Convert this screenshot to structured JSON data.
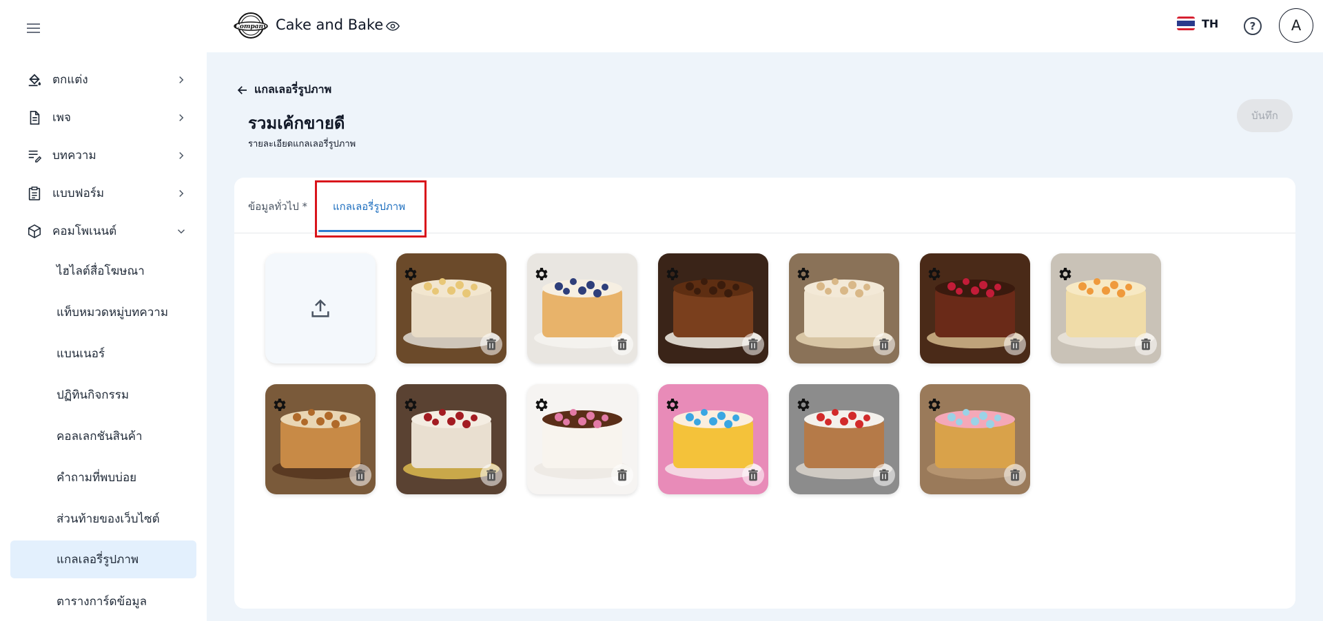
{
  "header": {
    "logo_text": "Company",
    "app_title": "Cake and Bake",
    "language": "TH",
    "avatar_initial": "A"
  },
  "sidebar": {
    "items": [
      {
        "label": "ตกแต่ง",
        "icon": "paint-bucket-icon"
      },
      {
        "label": "เพจ",
        "icon": "document-icon"
      },
      {
        "label": "บทความ",
        "icon": "article-edit-icon"
      },
      {
        "label": "แบบฟอร์ม",
        "icon": "clipboard-form-icon"
      },
      {
        "label": "คอมโพเนนต์",
        "icon": "cube-icon"
      }
    ],
    "subitems": [
      {
        "label": "ไฮไลต์สื่อโฆษณา"
      },
      {
        "label": "แท็บหมวดหมู่บทความ"
      },
      {
        "label": "แบนเนอร์"
      },
      {
        "label": "ปฏิทินกิจกรรม"
      },
      {
        "label": "คอลเลกชันสินค้า"
      },
      {
        "label": "คำถามที่พบบ่อย"
      },
      {
        "label": "ส่วนท้ายของเว็บไซต์"
      },
      {
        "label": "แกลเลอรี่รูปภาพ",
        "active": true
      },
      {
        "label": "ตารางการ์ดข้อมูล"
      }
    ]
  },
  "page": {
    "back_label": "แกลเลอรี่รูปภาพ",
    "title": "รวมเค้กขายดี",
    "subtitle": "รายละเอียดแกลเลอรี่รูปภาพ",
    "save_label": "บันทึก"
  },
  "tabs": [
    {
      "label": "ข้อมูลทั่วไป *",
      "active": false
    },
    {
      "label": "แกลเลอรี่รูปภาพ",
      "active": true
    }
  ],
  "gallery": {
    "upload_icon": "upload-icon",
    "images": [
      {
        "name": "banana-cream-cake",
        "bg": "#6b4a2a",
        "plate": "#cfc6ba",
        "body": "#e9dcc6",
        "top": "#f2e6cf",
        "deco": "#e8c777"
      },
      {
        "name": "blueberry-cake",
        "bg": "#e9e6e1",
        "plate": "#f4f2ee",
        "body": "#e8b36a",
        "top": "#f6efe2",
        "deco": "#2f3f7a"
      },
      {
        "name": "chocolate-cake",
        "bg": "#3a2418",
        "plate": "#d9d2c8",
        "body": "#7a3f1d",
        "top": "#5e2e12",
        "deco": "#3b1c0c"
      },
      {
        "name": "almond-rose-cake",
        "bg": "#8a7258",
        "plate": "#d8c5a4",
        "body": "#efe4d0",
        "top": "#f3e9d7",
        "deco": "#d9b888"
      },
      {
        "name": "raspberry-chocolate-cake",
        "bg": "#4a2a18",
        "plate": "#bfa37a",
        "body": "#6a2a18",
        "top": "#3a1a0e",
        "deco": "#c21c38"
      },
      {
        "name": "peach-mille-feuille",
        "bg": "#c9c2b7",
        "plate": "#e6e0d6",
        "body": "#f0dca8",
        "top": "#f7e9c4",
        "deco": "#ef9a3c"
      },
      {
        "name": "carrot-cake",
        "bg": "#7a5a3a",
        "plate": "#5a3a22",
        "body": "#c88a46",
        "top": "#e9d6b4",
        "deco": "#b06a2a"
      },
      {
        "name": "red-velvet-gold-cake",
        "bg": "#5a4232",
        "plate": "#c9a84a",
        "body": "#e9dfd0",
        "top": "#f4ede2",
        "deco": "#a31c22"
      },
      {
        "name": "birthday-drip-cake",
        "bg": "#f6f4f2",
        "plate": "#eeeae5",
        "body": "#f8f4ee",
        "top": "#5a2e18",
        "deco": "#e27aa6"
      },
      {
        "name": "rainbow-cake",
        "bg": "#e88bb8",
        "plate": "#f4d6e2",
        "body": "#f4c23a",
        "top": "#fbeede",
        "deco": "#3aa6e2"
      },
      {
        "name": "berry-fruit-tart",
        "bg": "#8c8c8c",
        "plate": "#cfcac3",
        "body": "#b57a48",
        "top": "#f4f1ec",
        "deco": "#d22b2b"
      },
      {
        "name": "cupcakes",
        "bg": "#9a7a5a",
        "plate": "#b59470",
        "body": "#d9a24a",
        "top": "#f4a8b8",
        "deco": "#9bd2e6"
      }
    ]
  }
}
